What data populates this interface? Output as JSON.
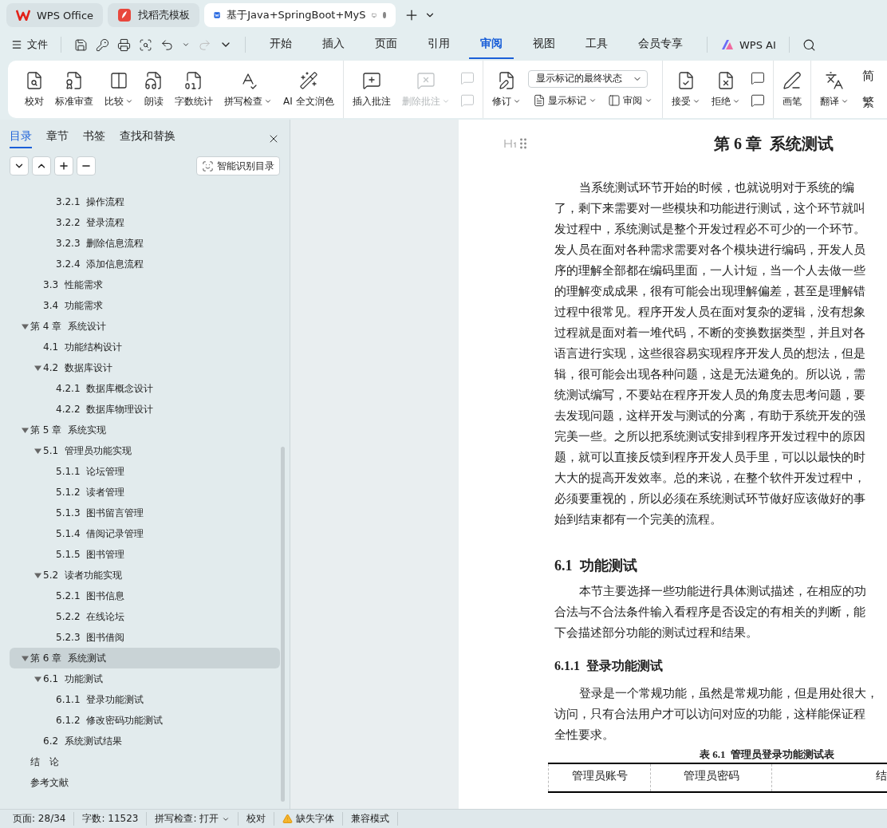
{
  "browser_tabs": [
    {
      "label": "WPS Office",
      "selected": false
    },
    {
      "label": "找稻壳模板",
      "selected": false
    },
    {
      "label": "基于Java+SpringBoot+MyS",
      "selected": true
    }
  ],
  "menu": {
    "file": "文件",
    "tabs": [
      {
        "label": "开始",
        "selected": false
      },
      {
        "label": "插入",
        "selected": false
      },
      {
        "label": "页面",
        "selected": false
      },
      {
        "label": "引用",
        "selected": false
      },
      {
        "label": "审阅",
        "selected": true
      },
      {
        "label": "视图",
        "selected": false
      },
      {
        "label": "工具",
        "selected": false
      },
      {
        "label": "会员专享",
        "selected": false
      }
    ],
    "ai": "WPS AI"
  },
  "ribbon": {
    "groups": [
      {
        "items": [
          {
            "kind": "large",
            "label": "校对",
            "dropdown": false,
            "disabled": false
          },
          {
            "kind": "large",
            "label": "标准审查",
            "dropdown": false,
            "disabled": false
          },
          {
            "kind": "large",
            "label": "比较",
            "dropdown": true,
            "disabled": false
          },
          {
            "kind": "large",
            "label": "朗读",
            "dropdown": false,
            "disabled": false
          },
          {
            "kind": "large",
            "label": "字数统计",
            "dropdown": false,
            "disabled": false
          },
          {
            "kind": "large",
            "label": "拼写检查",
            "dropdown": true,
            "disabled": false
          },
          {
            "kind": "large",
            "label": "AI 全文润色",
            "dropdown": false,
            "disabled": false
          }
        ]
      },
      {
        "items": [
          {
            "kind": "large",
            "label": "插入批注",
            "dropdown": false,
            "disabled": false
          },
          {
            "kind": "large",
            "label": "删除批注",
            "dropdown": true,
            "disabled": true
          },
          {
            "kind": "stack",
            "disabled": true
          }
        ]
      },
      {
        "items": [
          {
            "kind": "large",
            "label": "修订",
            "dropdown": true,
            "disabled": false
          },
          {
            "kind": "panel",
            "select": "显示标记的最终状态",
            "buttons": [
              {
                "label": "显示标记",
                "dropdown": true
              },
              {
                "label": "审阅",
                "dropdown": true
              }
            ]
          }
        ]
      },
      {
        "items": [
          {
            "kind": "large",
            "label": "接受",
            "dropdown": true,
            "disabled": false
          },
          {
            "kind": "large",
            "label": "拒绝",
            "dropdown": true,
            "disabled": false
          },
          {
            "kind": "stack",
            "disabled": false
          }
        ]
      },
      {
        "items": [
          {
            "kind": "large",
            "label": "画笔",
            "dropdown": false,
            "disabled": false
          }
        ]
      },
      {
        "items": [
          {
            "kind": "large",
            "label": "翻译",
            "dropdown": true,
            "disabled": false
          },
          {
            "kind": "glyphs",
            "glyphs": [
              "简",
              "繁"
            ]
          }
        ]
      }
    ]
  },
  "sidebar": {
    "tabs": [
      {
        "label": "目录",
        "selected": true
      },
      {
        "label": "章节",
        "selected": false
      },
      {
        "label": "书签",
        "selected": false
      },
      {
        "label": "查找和替换",
        "selected": false
      }
    ],
    "smart_button": "智能识别目录",
    "toc": [
      {
        "children": [
          {
            "children": [
              {
                "label": "3.2.1  操作流程",
                "selected": false
              },
              {
                "label": "3.2.2  登录流程",
                "selected": false
              },
              {
                "label": "3.2.3  删除信息流程",
                "selected": false
              },
              {
                "label": "3.2.4  添加信息流程",
                "selected": false
              }
            ]
          },
          {
            "label": "3.3  性能需求",
            "selected": false
          },
          {
            "label": "3.4  功能需求",
            "selected": false
          }
        ]
      },
      {
        "label": "第 4 章  系统设计",
        "selected": false,
        "expanded": true,
        "children": [
          {
            "label": "4.1  功能结构设计",
            "selected": false
          },
          {
            "label": "4.2  数据库设计",
            "selected": false,
            "expanded": true,
            "children": [
              {
                "label": "4.2.1  数据库概念设计",
                "selected": false
              },
              {
                "label": "4.2.2  数据库物理设计",
                "selected": false
              }
            ]
          }
        ]
      },
      {
        "label": "第 5 章  系统实现",
        "selected": false,
        "expanded": true,
        "children": [
          {
            "label": "5.1  管理员功能实现",
            "selected": false,
            "expanded": true,
            "children": [
              {
                "label": "5.1.1  论坛管理",
                "selected": false
              },
              {
                "label": "5.1.2  读者管理",
                "selected": false
              },
              {
                "label": "5.1.3  图书留言管理",
                "selected": false
              },
              {
                "label": "5.1.4  借阅记录管理",
                "selected": false
              },
              {
                "label": "5.1.5  图书管理",
                "selected": false
              }
            ]
          },
          {
            "label": "5.2  读者功能实现",
            "selected": false,
            "expanded": true,
            "children": [
              {
                "label": "5.2.1  图书信息",
                "selected": false
              },
              {
                "label": "5.2.2  在线论坛",
                "selected": false
              },
              {
                "label": "5.2.3  图书借阅",
                "selected": false
              }
            ]
          }
        ]
      },
      {
        "label": "第 6 章  系统测试",
        "selected": true,
        "expanded": true,
        "children": [
          {
            "label": "6.1  功能测试",
            "selected": false,
            "expanded": true,
            "children": [
              {
                "label": "6.1.1  登录功能测试",
                "selected": false
              },
              {
                "label": "6.1.2  修改密码功能测试",
                "selected": false
              }
            ]
          },
          {
            "label": "6.2  系统测试结果",
            "selected": false
          }
        ]
      },
      {
        "label": "结　论",
        "selected": false
      },
      {
        "label": "参考文献",
        "selected": false
      }
    ]
  },
  "document": {
    "title": "第 6 章  系统测试",
    "blocks": [
      {
        "kind": "paragraph",
        "lines": [
          "当系统测试环节开始的时候，也就说明对于系统的编",
          "了，剩下来需要对一些模块和功能进行测试，这个环节就叫",
          "发过程中，系统测试是整个开发过程必不可少的一个环节。",
          "发人员在面对各种需求需要对各个模块进行编码，开发人员",
          "序的理解全部都在编码里面，一人计短，当一个人去做一些",
          "的理解变成成果，很有可能会出现理解偏差，甚至是理解错",
          "过程中很常见。程序开发人员在面对复杂的逻辑，没有想象",
          "过程就是面对着一堆代码，不断的变换数据类型，并且对各",
          "语言进行实现，这些很容易实现程序开发人员的想法，但是",
          "辑，很可能会出现各种问题，这是无法避免的。所以说，需",
          "统测试编写，不要站在程序开发人员的角度去思考问题，要",
          "去发现问题，这样开发与测试的分离，有助于系统开发的强",
          "完美一些。之所以把系统测试安排到程序开发过程中的原因",
          "题，就可以直接反馈到程序开发人员手里，可以以最快的时",
          "大大的提高开发效率。总的来说，在整个软件开发过程中，",
          "必须要重视的，所以必须在系统测试环节做好应该做好的事",
          "始到结束都有一个完美的流程。"
        ]
      },
      {
        "kind": "heading2",
        "text": "6.1  功能测试"
      },
      {
        "kind": "paragraph",
        "lines": [
          "本节主要选择一些功能进行具体测试描述，在相应的功",
          "合法与不合法条件输入看程序是否设定的有相关的判断，能",
          "下会描述部分功能的测试过程和结果。"
        ]
      },
      {
        "kind": "heading3",
        "text": "6.1.1  登录功能测试"
      },
      {
        "kind": "paragraph",
        "lines": [
          "登录是一个常规功能，虽然是常规功能，但是用处很大，",
          "访问，只有合法用户才可以访问对应的功能，这样能保证程",
          "全性要求。"
        ]
      },
      {
        "kind": "caption",
        "text": "表 6.1  管理员登录功能测试表"
      },
      {
        "kind": "table",
        "columns": [
          "管理员账号",
          "管理员密码",
          "结"
        ]
      }
    ]
  },
  "status_bar": [
    {
      "kind": "text",
      "label": "页面: 28/34"
    },
    {
      "kind": "text",
      "label": "字数: 11523"
    },
    {
      "kind": "dropdown",
      "label": "拼写检查: 打开"
    },
    {
      "kind": "text",
      "label": "校对"
    },
    {
      "kind": "warning",
      "label": "缺失字体"
    },
    {
      "kind": "text",
      "label": "兼容模式"
    }
  ]
}
